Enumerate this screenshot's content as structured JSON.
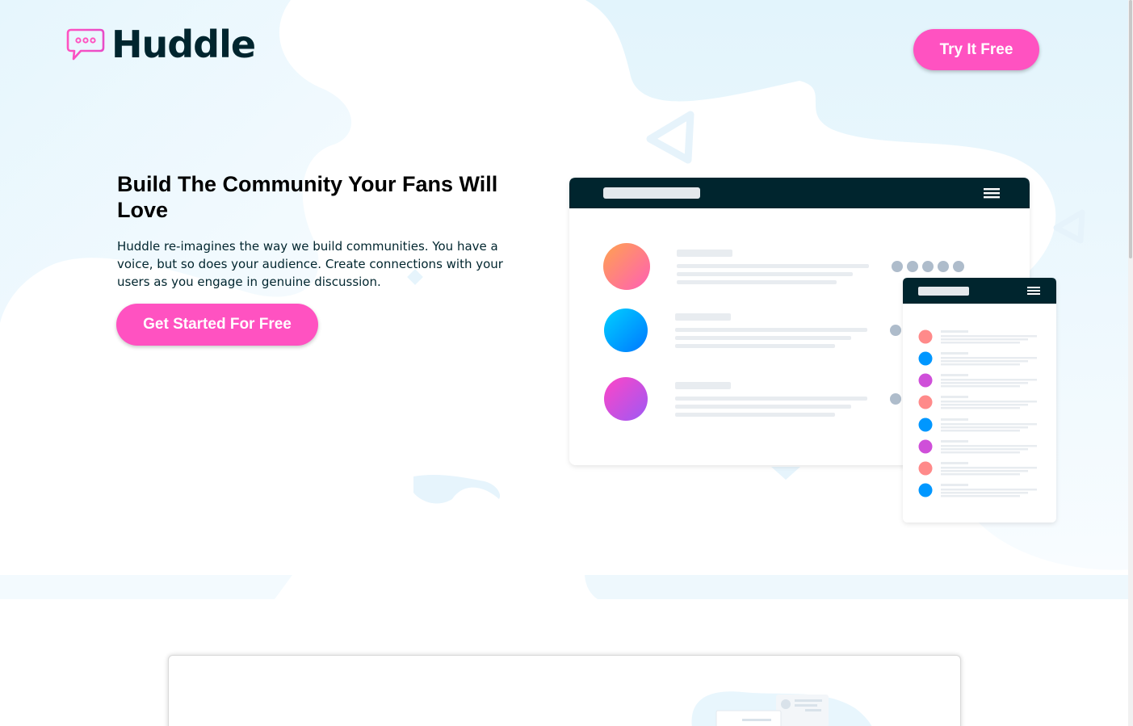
{
  "brand": {
    "name": "Huddle",
    "logo_icon": "chat-bubble-icon",
    "accent_color": "#ff52c1",
    "dark_color": "#00252e",
    "bg_blob_color": "#e8f6fd"
  },
  "header": {
    "cta_label": "Try It Free"
  },
  "hero": {
    "title": "Build The Community Your Fans Will Love",
    "description": "Huddle re-imagines the way we build communities. You have a voice, but so does your audience. Create connections with your users as you engage in genuine discussion.",
    "cta_label": "Get Started For Free"
  },
  "illustration": {
    "desktop_window": {
      "menu_icon": "hamburger-icon",
      "avatar_gradients": [
        [
          "#ff9a56",
          "#ff6fb0"
        ],
        [
          "#00c4ff",
          "#0088ff"
        ],
        [
          "#ff4fc9",
          "#a855f7"
        ]
      ]
    },
    "mobile_window": {
      "menu_icon": "hamburger-icon",
      "dot_colors": [
        "#ff7f96",
        "#0096ff",
        "#d44fd6",
        "#ff7f96",
        "#0096ff",
        "#d44fd6",
        "#ff7f96",
        "#0096ff"
      ]
    }
  }
}
